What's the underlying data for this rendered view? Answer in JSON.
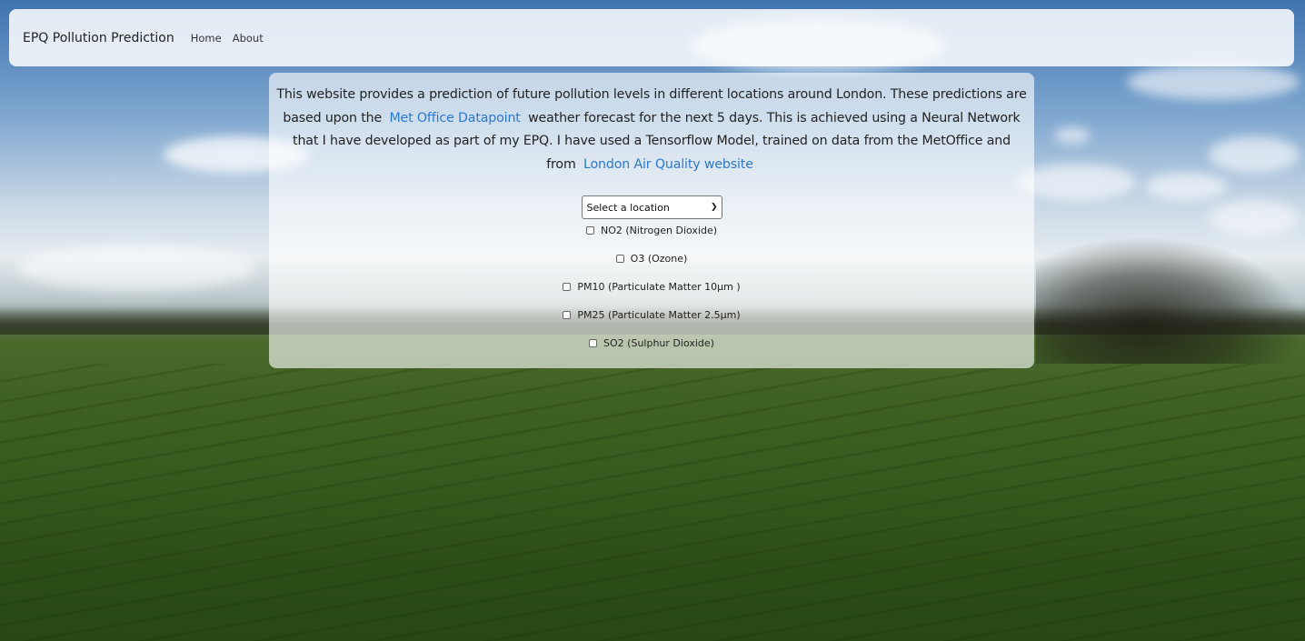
{
  "navbar": {
    "brand": "EPQ Pollution Prediction",
    "links": [
      "Home",
      "About"
    ]
  },
  "intro": {
    "part1": "This website provides a prediction of future pollution levels in different locations around London. These predictions are based upon the",
    "link1": "Met Office Datapoint",
    "part2": "weather forecast for the next 5 days. This is achieved using a Neural Network that I have developed as part of my EPQ. I have used a Tensorflow Model, trained on data from the MetOffice and from",
    "link2": "London Air Quality website"
  },
  "location_select": {
    "selected": "Select a location"
  },
  "pollutants": [
    {
      "label": "NO2 (Nitrogen Dioxide)",
      "checked": false
    },
    {
      "label": "O3 (Ozone)",
      "checked": false
    },
    {
      "label": "PM10 (Particulate Matter 10μm )",
      "checked": false
    },
    {
      "label": "PM25 (Particulate Matter 2.5μm)",
      "checked": false
    },
    {
      "label": "SO2 (Sulphur Dioxide)",
      "checked": false
    }
  ]
}
